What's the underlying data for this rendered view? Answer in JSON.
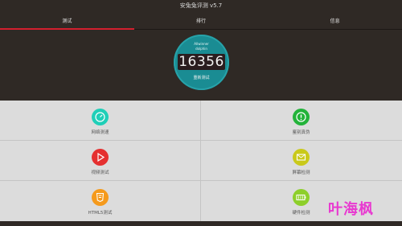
{
  "window": {
    "title": "安兔兔评测 v5.7"
  },
  "tabs": [
    {
      "label": "测试",
      "active": true
    },
    {
      "label": "排行",
      "active": false
    },
    {
      "label": "信息",
      "active": false
    }
  ],
  "device": {
    "line1": "Allwinner",
    "line2": "dolphin"
  },
  "benchmark": {
    "score": "16356",
    "retest_label": "重新测试"
  },
  "tests": [
    {
      "label": "网络测速",
      "icon": "speedometer-icon",
      "color": "#1fcfb8"
    },
    {
      "label": "鉴别真伪",
      "icon": "alert-icon",
      "color": "#23b33a"
    },
    {
      "label": "视频测试",
      "icon": "play-icon",
      "color": "#e53030"
    },
    {
      "label": "屏幕检测",
      "icon": "screen-icon",
      "color": "#c9c91a"
    },
    {
      "label": "HTML5测试",
      "icon": "html5-icon",
      "color": "#f59a1c"
    },
    {
      "label": "硬件检测",
      "icon": "battery-icon",
      "color": "#8dcf2a"
    }
  ],
  "watermark": {
    "text": "叶海枫"
  },
  "colors": {
    "accent": "#d21f2e",
    "dial": "#1a8c93",
    "background": "#2f2925",
    "grid": "#dcdcdc"
  }
}
